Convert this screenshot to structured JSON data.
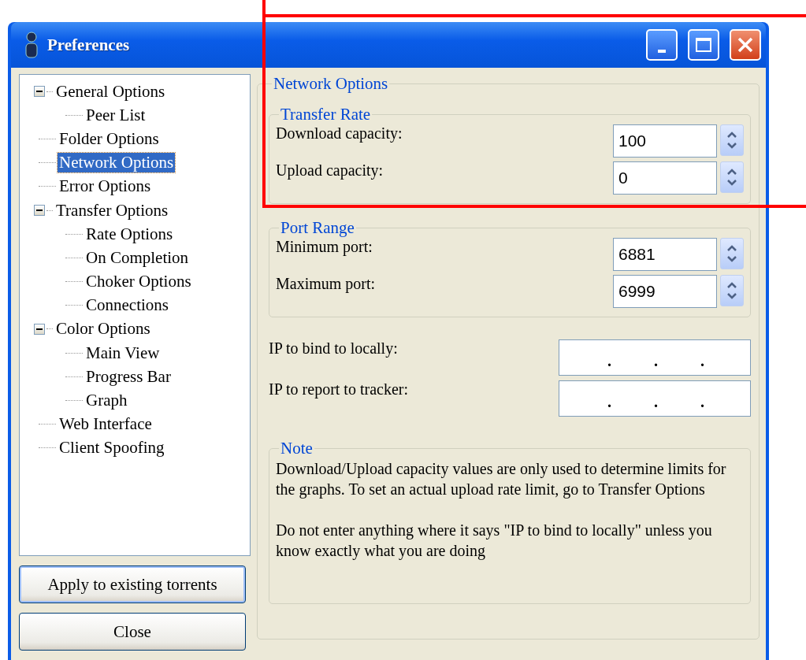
{
  "window": {
    "title": "Preferences"
  },
  "tree": [
    {
      "label": "General Options",
      "expanded": true,
      "selected": false,
      "children": [
        {
          "label": "Peer List",
          "selected": false
        }
      ]
    },
    {
      "label": "Folder Options",
      "selected": false
    },
    {
      "label": "Network Options",
      "selected": true
    },
    {
      "label": "Error Options",
      "selected": false
    },
    {
      "label": "Transfer Options",
      "expanded": true,
      "selected": false,
      "children": [
        {
          "label": "Rate Options",
          "selected": false
        },
        {
          "label": "On Completion",
          "selected": false
        },
        {
          "label": "Choker Options",
          "selected": false
        },
        {
          "label": "Connections",
          "selected": false
        }
      ]
    },
    {
      "label": "Color Options",
      "expanded": true,
      "selected": false,
      "children": [
        {
          "label": "Main View",
          "selected": false
        },
        {
          "label": "Progress Bar",
          "selected": false
        },
        {
          "label": "Graph",
          "selected": false
        }
      ]
    },
    {
      "label": "Web Interface",
      "selected": false
    },
    {
      "label": "Client Spoofing",
      "selected": false
    }
  ],
  "buttons": [
    "Apply to existing torrents",
    "Close"
  ],
  "panel": {
    "title": "Network Options",
    "groups": [
      {
        "title": "Transfer Rate",
        "fields": [
          {
            "label": "Download capacity:",
            "value": "100"
          },
          {
            "label": "Upload capacity:",
            "value": "0"
          }
        ]
      },
      {
        "title": "Port Range",
        "fields": [
          {
            "label": "Minimum port:",
            "value": "6881"
          },
          {
            "label": "Maximum port:",
            "value": "6999"
          }
        ]
      }
    ],
    "ip_fields": [
      {
        "label": "IP to bind to locally:",
        "separator": "."
      },
      {
        "label": "IP to report to tracker:",
        "separator": "."
      }
    ],
    "note": {
      "title": "Note",
      "paragraphs": [
        "Download/Upload capacity values are only used to determine limits for the graphs. To set an actual upload rate limit, go to Transfer Options",
        "Do not enter anything where it says \"IP to bind to locally\" unless you know exactly what you are doing"
      ]
    }
  }
}
